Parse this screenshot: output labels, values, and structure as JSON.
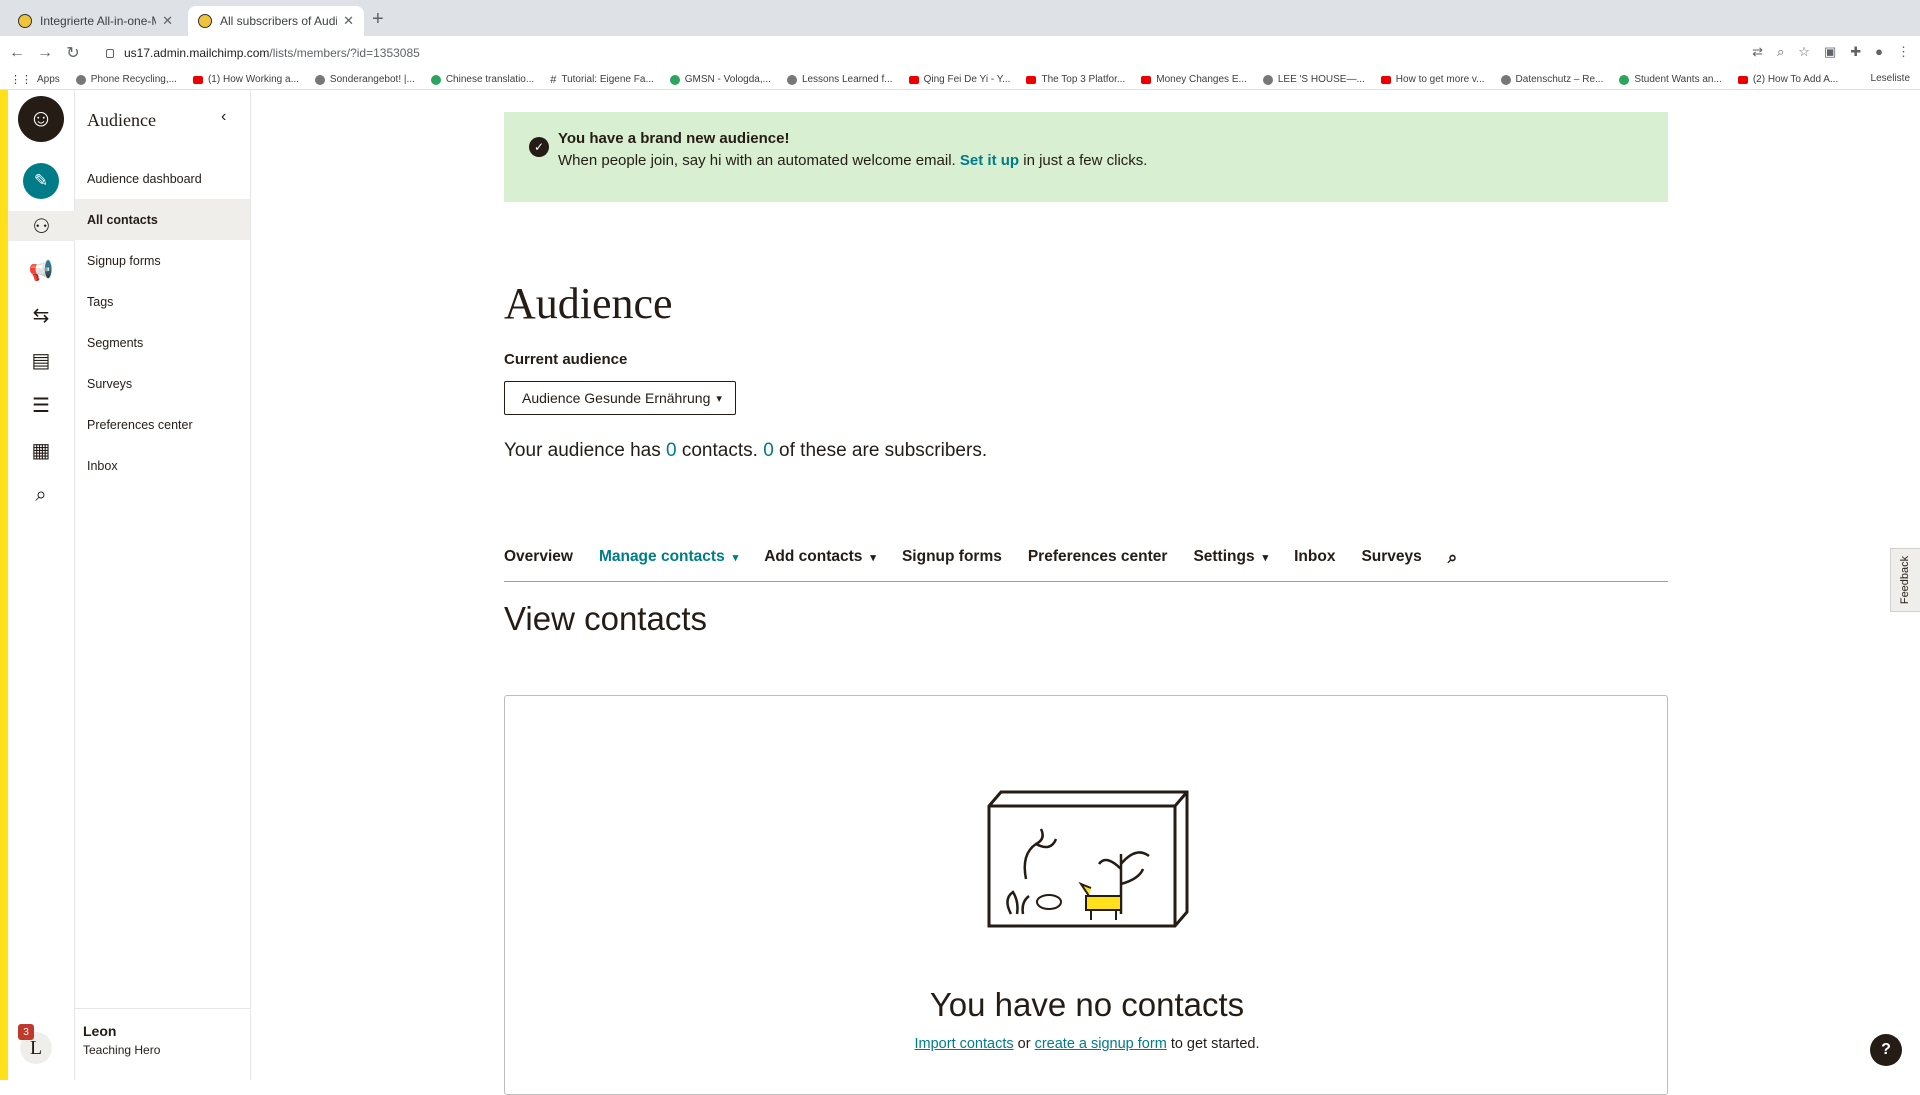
{
  "browser": {
    "tabs": [
      {
        "title": "Integrierte All-in-one-Marketin"
      },
      {
        "title": "All subscribers of Audience Ge"
      }
    ],
    "url_host": "us17.admin.mailchimp.com",
    "url_path": "/lists/members/?id=1353085",
    "bookmarks": [
      {
        "label": "Apps"
      },
      {
        "label": "Phone Recycling,..."
      },
      {
        "label": "(1) How Working a..."
      },
      {
        "label": "Sonderangebot! |..."
      },
      {
        "label": "Chinese translatio..."
      },
      {
        "label": "Tutorial: Eigene Fa..."
      },
      {
        "label": "GMSN - Vologda,..."
      },
      {
        "label": "Lessons Learned f..."
      },
      {
        "label": "Qing Fei De Yi - Y..."
      },
      {
        "label": "The Top 3 Platfor..."
      },
      {
        "label": "Money Changes E..."
      },
      {
        "label": "LEE 'S HOUSE—..."
      },
      {
        "label": "How to get more v..."
      },
      {
        "label": "Datenschutz – Re..."
      },
      {
        "label": "Student Wants an..."
      },
      {
        "label": "(2) How To Add A..."
      }
    ],
    "reading_list": "Leseliste"
  },
  "rail": {
    "badge_count": "3",
    "avatar_letter": "L"
  },
  "sidenav": {
    "heading": "Audience",
    "items": [
      {
        "label": "Audience dashboard"
      },
      {
        "label": "All contacts"
      },
      {
        "label": "Signup forms"
      },
      {
        "label": "Tags"
      },
      {
        "label": "Segments"
      },
      {
        "label": "Surveys"
      },
      {
        "label": "Preferences center"
      },
      {
        "label": "Inbox"
      }
    ],
    "user_name": "Leon",
    "user_role": "Teaching Hero"
  },
  "banner": {
    "title": "You have a brand new audience!",
    "body_pre": "When people join, say hi with an automated welcome email.",
    "link": "Set it up",
    "body_post": "in just a few clicks."
  },
  "main": {
    "title": "Audience",
    "current_label": "Current audience",
    "current_value": "Audience Gesunde Ernährung",
    "summary_pre": "Your audience has",
    "contacts": "0",
    "summary_mid": "contacts.",
    "subscribers": "0",
    "summary_post": "of these are subscribers.",
    "tabs": [
      {
        "label": "Overview"
      },
      {
        "label": "Manage contacts"
      },
      {
        "label": "Add contacts"
      },
      {
        "label": "Signup forms"
      },
      {
        "label": "Preferences center"
      },
      {
        "label": "Settings"
      },
      {
        "label": "Inbox"
      },
      {
        "label": "Surveys"
      }
    ],
    "section_title": "View contacts",
    "empty_title": "You have no contacts",
    "import_link": "Import contacts",
    "or_text": "or",
    "signup_link": "create a signup form",
    "get_started": "to get started."
  },
  "feedback": "Feedback",
  "help": "?"
}
